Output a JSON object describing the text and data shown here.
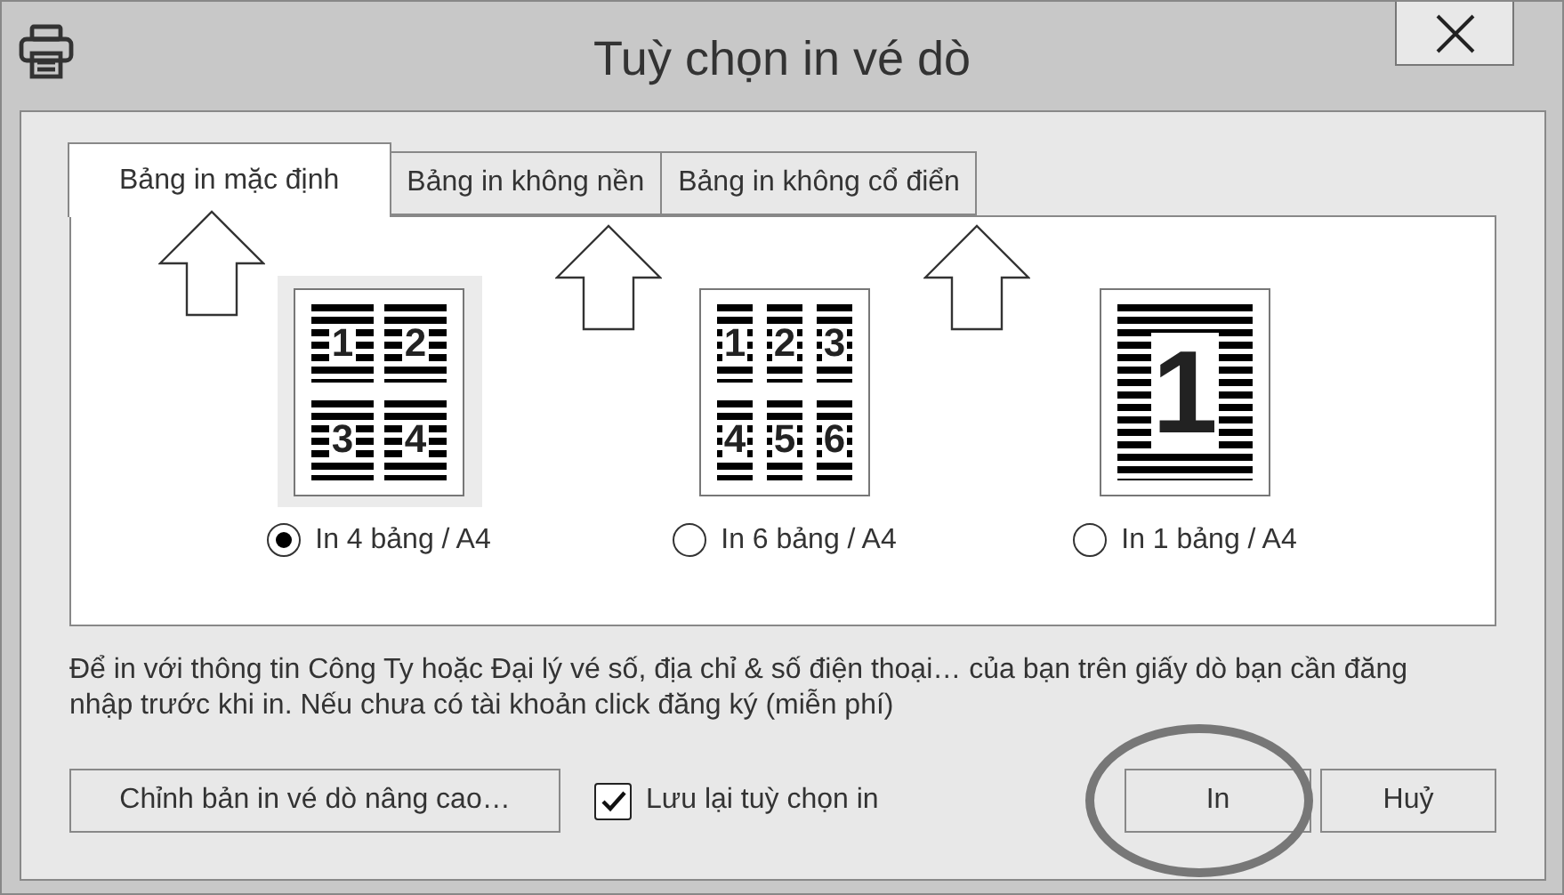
{
  "window": {
    "title": "Tuỳ chọn in vé dò"
  },
  "tabs": [
    {
      "label": "Bảng in mặc định",
      "selected": true,
      "pointer": true
    },
    {
      "label": "Bảng in không nền",
      "selected": false,
      "pointer": true
    },
    {
      "label": "Bảng in không cổ điển",
      "selected": false,
      "pointer": true
    }
  ],
  "layouts": [
    {
      "kind": "two-column",
      "numbers": [
        "1",
        "2",
        "3",
        "4"
      ],
      "label": "In 4 bảng / A4",
      "selected": true
    },
    {
      "kind": "three-column",
      "numbers": [
        "1",
        "2",
        "3",
        "4",
        "5",
        "6"
      ],
      "label": "In 6 bảng / A4",
      "selected": false
    },
    {
      "kind": "single",
      "numbers": [
        "1"
      ],
      "label": "In 1 bảng / A4",
      "selected": false
    }
  ],
  "note": "Để in với thông tin Công Ty hoặc Đại lý vé số, địa chỉ & số điện thoại… của bạn trên giấy dò bạn cần đăng nhập trước khi in. Nếu chưa có tài khoản click đăng ký (miễn phí)",
  "advanced_button": "Chỉnh bản in vé dò nâng cao…",
  "remember": {
    "label": "Lưu lại tuỳ chọn in",
    "checked": true
  },
  "actions": [
    {
      "label": "In",
      "highlighted": true
    },
    {
      "label": "Huỷ",
      "highlighted": false
    }
  ]
}
